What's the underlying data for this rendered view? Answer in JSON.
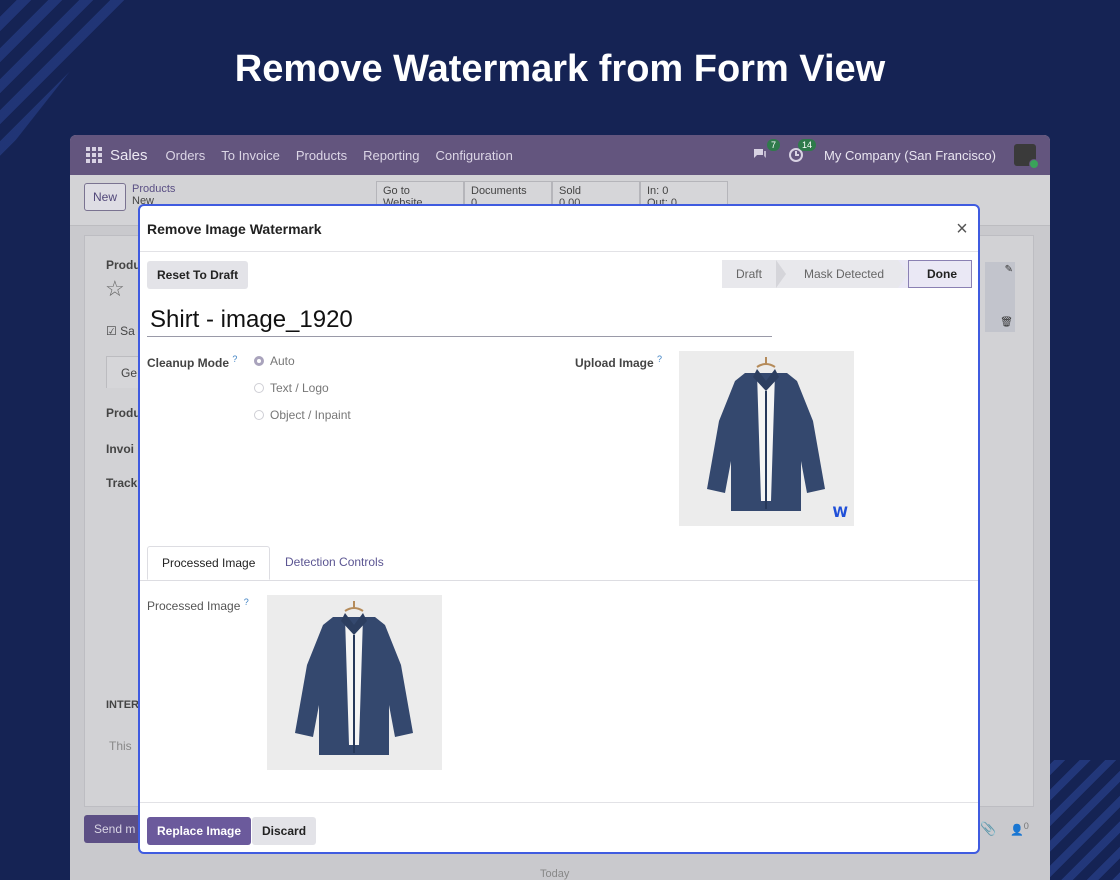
{
  "hero": {
    "title": "Remove Watermark from Form View"
  },
  "navbar": {
    "app": "Sales",
    "menu": [
      "Orders",
      "To Invoice",
      "Products",
      "Reporting",
      "Configuration"
    ],
    "messages_count": "7",
    "activities_count": "14",
    "company": "My Company (San Francisco)"
  },
  "control": {
    "new_label": "New",
    "breadcrumb_parent": "Products",
    "breadcrumb_current": "New",
    "smart_buttons": [
      {
        "label": "Go to",
        "sub": "Website"
      },
      {
        "label": "Documents",
        "sub": "0"
      },
      {
        "label": "Sold",
        "sub": "0.00"
      },
      {
        "label": "In: 0",
        "sub": "Out: 0"
      }
    ]
  },
  "background_form": {
    "product_label": "Produ",
    "sales_label": "Sa",
    "tab_general": "Ge",
    "row1": "Produ",
    "row2": "Invoi",
    "row3": "Track",
    "internal": "INTER",
    "this_text": "This",
    "send_label": "Send m",
    "today": "Today",
    "follower_count": "0"
  },
  "modal": {
    "title": "Remove Image Watermark",
    "reset_label": "Reset To Draft",
    "stages": [
      {
        "label": "Draft",
        "active": false
      },
      {
        "label": "Mask Detected",
        "active": false
      },
      {
        "label": "Done",
        "active": true
      }
    ],
    "name_value": "Shirt - image_1920",
    "cleanup_label": "Cleanup Mode",
    "cleanup_options": [
      {
        "label": "Auto",
        "selected": true
      },
      {
        "label": "Text / Logo",
        "selected": false
      },
      {
        "label": "Object / Inpaint",
        "selected": false
      }
    ],
    "upload_label": "Upload Image",
    "watermark_mark": "W",
    "tabs": [
      {
        "label": "Processed Image",
        "active": true
      },
      {
        "label": "Detection Controls",
        "active": false
      }
    ],
    "processed_label": "Processed Image",
    "help_mark": "?",
    "replace_label": "Replace Image",
    "discard_label": "Discard"
  },
  "colors": {
    "page_bg": "#152354",
    "navbar": "#63557e",
    "primary": "#6b5a9c",
    "modal_border": "#3f5be0",
    "shirt": "#34486e"
  }
}
